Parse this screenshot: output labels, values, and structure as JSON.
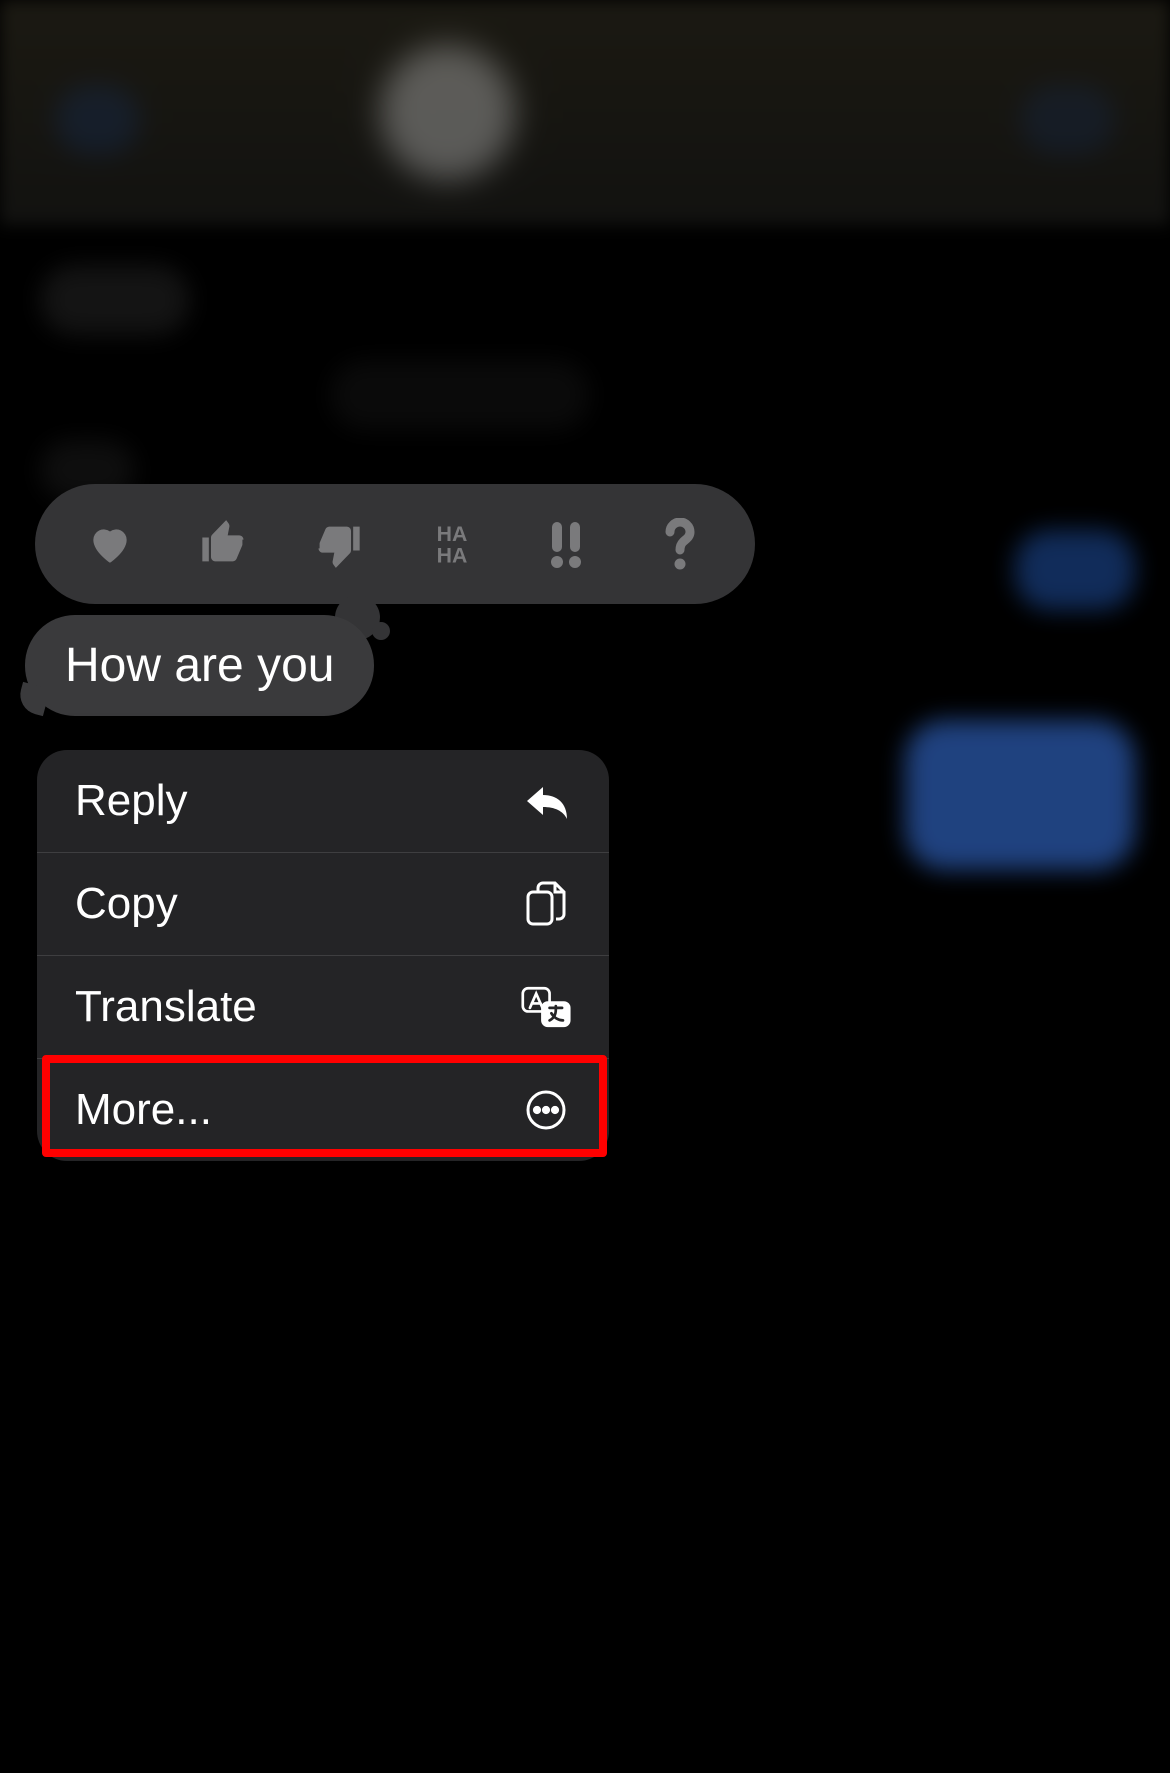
{
  "message": {
    "text": "How are you"
  },
  "tapbacks": [
    {
      "name": "heart"
    },
    {
      "name": "thumbs-up"
    },
    {
      "name": "thumbs-down"
    },
    {
      "name": "haha"
    },
    {
      "name": "exclaim"
    },
    {
      "name": "question"
    }
  ],
  "menu": {
    "reply": "Reply",
    "copy": "Copy",
    "translate": "Translate",
    "more": "More..."
  }
}
